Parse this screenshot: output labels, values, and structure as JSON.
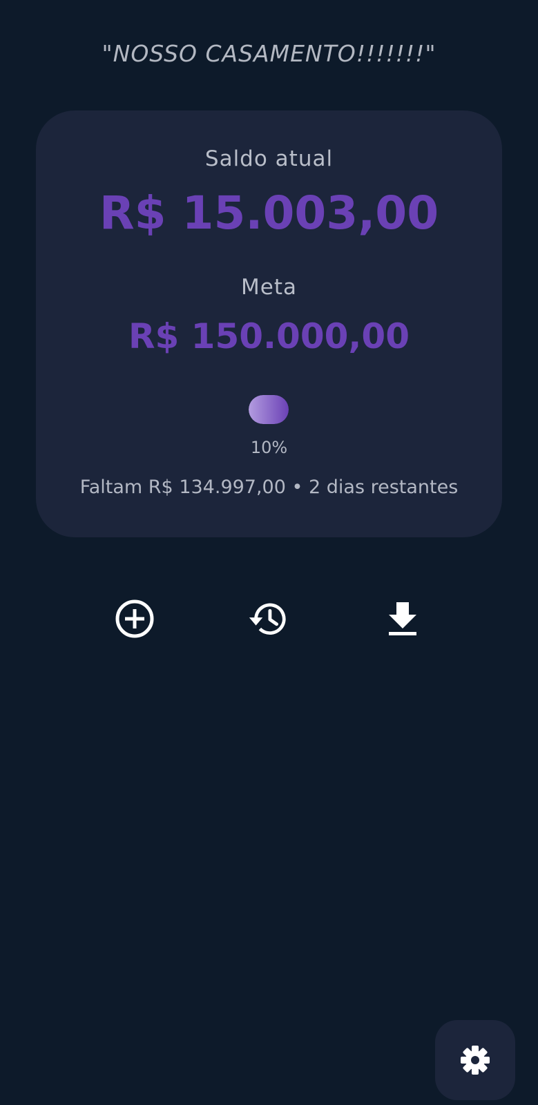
{
  "header": {
    "title": "\"NOSSO CASAMENTO!!!!!!!\""
  },
  "summary": {
    "balance_label": "Saldo atual",
    "balance_value": "R$ 15.003,00",
    "goal_label": "Meta",
    "goal_value": "R$ 150.000,00",
    "progress_fraction": 0.1,
    "progress_text": "10%",
    "remaining_text": "Faltam R$ 134.997,00 • 2 dias restantes"
  },
  "actions": [
    {
      "icon": "add-circle-icon"
    },
    {
      "icon": "history-icon"
    },
    {
      "icon": "download-icon"
    }
  ],
  "settings": {
    "icon": "gear-icon"
  },
  "colors": {
    "background": "#0d1a2a",
    "card": "#1c253b",
    "accent": "#6a41b5",
    "progress_start": "#b39ce0",
    "text_muted": "#b3b8c4"
  }
}
